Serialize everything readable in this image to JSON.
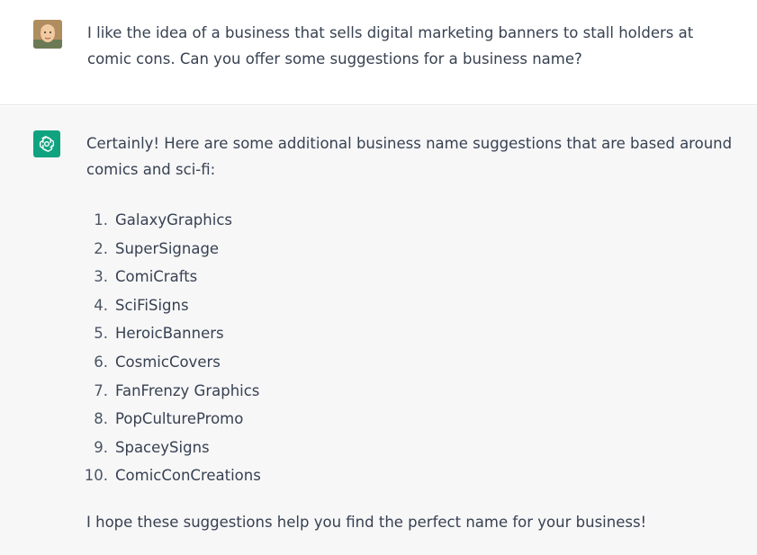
{
  "user_message": {
    "text": "I like the idea of a business that sells digital marketing banners to stall holders at comic cons. Can you offer some suggestions for a business name?"
  },
  "assistant_message": {
    "intro": "Certainly! Here are some additional business name suggestions that are based around comics and sci-fi:",
    "suggestions": [
      {
        "num": "1.",
        "name": "GalaxyGraphics"
      },
      {
        "num": "2.",
        "name": "SuperSignage"
      },
      {
        "num": "3.",
        "name": "ComiCrafts"
      },
      {
        "num": "4.",
        "name": "SciFiSigns"
      },
      {
        "num": "5.",
        "name": "HeroicBanners"
      },
      {
        "num": "6.",
        "name": "CosmicCovers"
      },
      {
        "num": "7.",
        "name": "FanFrenzy Graphics"
      },
      {
        "num": "8.",
        "name": "PopCulturePromo"
      },
      {
        "num": "9.",
        "name": "SpaceySigns"
      },
      {
        "num": "10.",
        "name": "ComicConCreations"
      }
    ],
    "closing": "I hope these suggestions help you find the perfect name for your business!"
  },
  "colors": {
    "user_bg": "#ffffff",
    "assistant_bg": "#f7f7f8",
    "bot_avatar": "#10a37f",
    "text": "#374151"
  },
  "icons": {
    "user_avatar": "user-avatar-icon",
    "bot_avatar": "openai-logo-icon"
  }
}
